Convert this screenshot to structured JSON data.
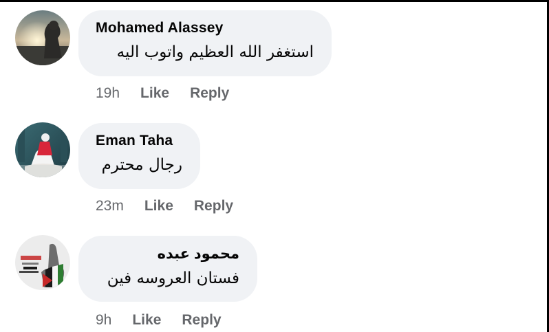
{
  "comments": [
    {
      "author": "Mohamed Alassey",
      "text": "استغفر الله العظيم واتوب اليه",
      "time": "19h",
      "like_label": "Like",
      "reply_label": "Reply"
    },
    {
      "author": "Eman Taha",
      "text": "رجال محترم",
      "time": "23m",
      "like_label": "Like",
      "reply_label": "Reply"
    },
    {
      "author": "محمود عبده",
      "text": "فستان العروسه فين",
      "time": "9h",
      "like_label": "Like",
      "reply_label": "Reply"
    }
  ],
  "colors": {
    "bubble_bg": "#f0f2f5",
    "text": "#050505",
    "secondary": "#65676b"
  }
}
